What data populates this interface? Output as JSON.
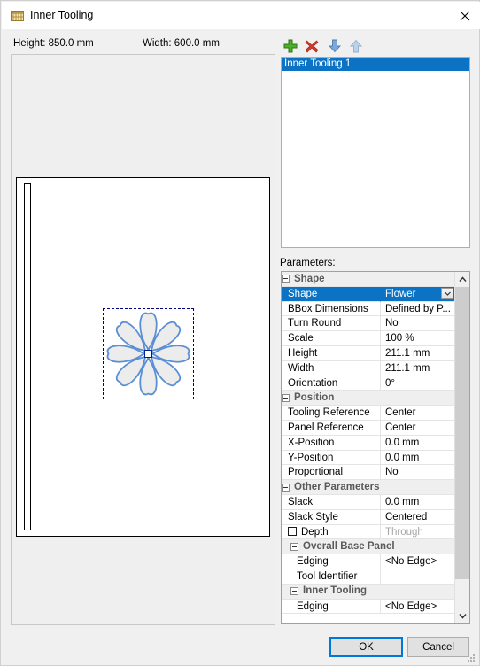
{
  "window": {
    "title": "Inner Tooling",
    "icon": "inner-tooling-icon",
    "close_label": "✕"
  },
  "header": {
    "height_label": "Height: 850.0 mm",
    "width_label": "Width: 600.0 mm"
  },
  "toolbar": {
    "add_label": "Add",
    "delete_label": "Delete",
    "move_down_label": "Move Down",
    "move_up_label": "Move Up"
  },
  "list": {
    "items": [
      {
        "label": "Inner Tooling 1",
        "selected": true
      }
    ]
  },
  "parameters": {
    "label": "Parameters:",
    "rows": [
      {
        "type": "group",
        "key": "Shape",
        "indent": 0
      },
      {
        "type": "row",
        "key": "Shape",
        "value": "Flower",
        "selected": true,
        "dropdown": true,
        "indent": 0
      },
      {
        "type": "row",
        "key": "BBox Dimensions",
        "value": "Defined by P...",
        "indent": 0
      },
      {
        "type": "row",
        "key": "Turn Round",
        "value": "No",
        "indent": 0
      },
      {
        "type": "row",
        "key": "Scale",
        "value": "100 %",
        "indent": 0
      },
      {
        "type": "row",
        "key": "Height",
        "value": "211.1 mm",
        "indent": 0
      },
      {
        "type": "row",
        "key": "Width",
        "value": "211.1 mm",
        "indent": 0
      },
      {
        "type": "row",
        "key": "Orientation",
        "value": "0°",
        "indent": 0
      },
      {
        "type": "group",
        "key": "Position",
        "indent": 0
      },
      {
        "type": "row",
        "key": "Tooling Reference",
        "value": "Center",
        "indent": 0
      },
      {
        "type": "row",
        "key": "Panel Reference",
        "value": "Center",
        "indent": 0
      },
      {
        "type": "row",
        "key": "X-Position",
        "value": "0.0 mm",
        "indent": 0
      },
      {
        "type": "row",
        "key": "Y-Position",
        "value": "0.0 mm",
        "indent": 0
      },
      {
        "type": "row",
        "key": "Proportional",
        "value": "No",
        "indent": 0
      },
      {
        "type": "group",
        "key": "Other Parameters",
        "indent": 0
      },
      {
        "type": "row",
        "key": "Slack",
        "value": "0.0 mm",
        "indent": 0
      },
      {
        "type": "row",
        "key": "Slack Style",
        "value": "Centered",
        "indent": 0
      },
      {
        "type": "row",
        "key": "Depth",
        "value": "Through",
        "checkbox": true,
        "checked": false,
        "dimmed": true,
        "indent": 0
      },
      {
        "type": "group",
        "key": "Overall Base Panel",
        "indent": 1
      },
      {
        "type": "row",
        "key": "Edging",
        "value": "<No Edge>",
        "indent": 1
      },
      {
        "type": "row",
        "key": "Tool Identifier",
        "value": "",
        "indent": 1
      },
      {
        "type": "group",
        "key": "Inner Tooling",
        "indent": 1
      },
      {
        "type": "row",
        "key": "Edging",
        "value": "<No Edge>",
        "indent": 1
      }
    ]
  },
  "preview": {
    "shape_name": "Flower",
    "petal_count": 8,
    "panel_height_mm": "850.0",
    "panel_width_mm": "600.0",
    "shape_size_mm": "211.1",
    "shape_fill": "#ececec",
    "shape_stroke": "#5b8fd4",
    "bbox_stroke": "#000080"
  },
  "footer": {
    "ok_label": "OK",
    "cancel_label": "Cancel"
  },
  "colors": {
    "selection_blue": "#0b72c4",
    "focus_blue": "#0078d7",
    "window_bg": "#f0f0f0",
    "panel_white": "#ffffff"
  }
}
